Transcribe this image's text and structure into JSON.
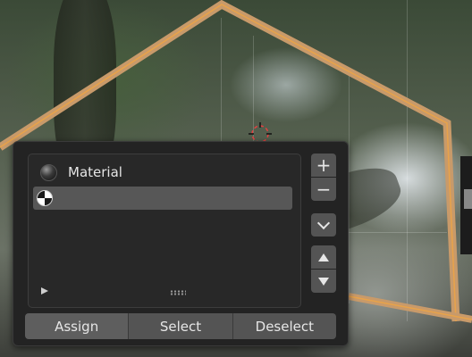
{
  "material_panel": {
    "slots": [
      {
        "label": "Material",
        "icon": "material-sphere-icon",
        "active": false
      },
      {
        "label": "",
        "icon": "checker-sphere-icon",
        "active": true
      }
    ],
    "side_buttons": {
      "add": "+",
      "remove": "−"
    },
    "actions": {
      "assign": "Assign",
      "select": "Select",
      "deselect": "Deselect"
    }
  },
  "colors": {
    "panel_bg": "#232323",
    "button_bg": "#545454",
    "active_slot": "#575757",
    "selection_outline": "#e8a34a",
    "text": "#e6e6e6"
  }
}
